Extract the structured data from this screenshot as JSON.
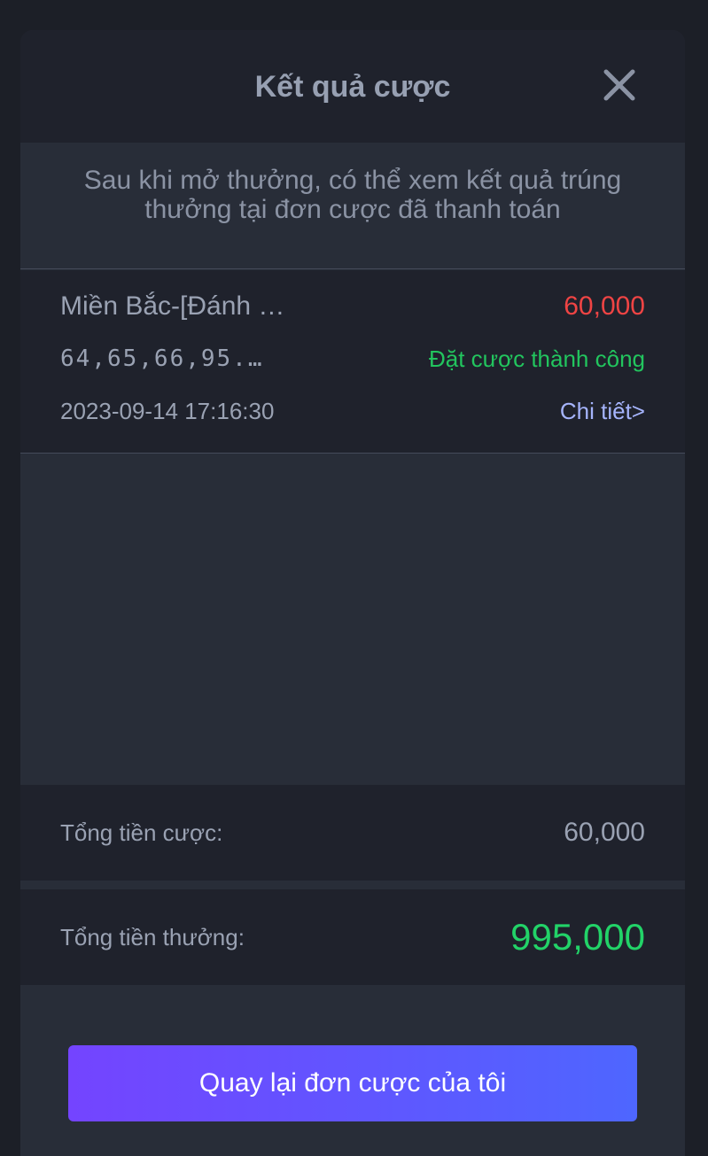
{
  "header": {
    "title": "Kết quả cược",
    "close_icon": "close-icon"
  },
  "notice": {
    "text": "Sau khi mở thưởng, có thể xem kết quả trúng thưởng tại đơn cược đã thanh toán"
  },
  "bet": {
    "name": "Miền Bắc-[Đánh …",
    "amount": "60,000",
    "numbers": "64,65,66,95...",
    "status": "Đặt cược thành công",
    "time": "2023-09-14 17:16:30",
    "detail_link": "Chi tiết>"
  },
  "totals": {
    "bet_label": "Tổng tiền cược:",
    "bet_value": "60,000",
    "win_label": "Tổng tiền thưởng:",
    "win_value": "995,000"
  },
  "actions": {
    "back_label": "Quay lại đơn cược của tôi"
  },
  "colors": {
    "background": "#1c1f27",
    "panel": "#282d38",
    "row": "#1f222c",
    "amount_red": "#ef4444",
    "success_green": "#22c55e",
    "link": "#a5b4fc",
    "button_gradient_start": "#7444ff",
    "button_gradient_end": "#4e66ff"
  }
}
